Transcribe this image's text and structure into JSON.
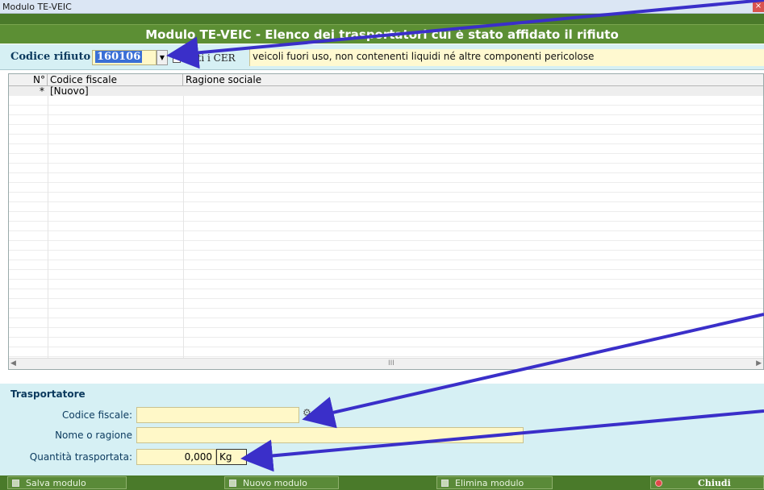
{
  "window": {
    "title": "Modulo TE-VEIC",
    "close_glyph": "×"
  },
  "banner": {
    "title": "Modulo TE-VEIC - Elenco dei trasportatori cui è stato affidato il rifiuto"
  },
  "codice_rifiuto": {
    "label": "Codice rifiuto",
    "value": "160106",
    "dropdown_glyph": "▼",
    "tutti_label": "Tutti i CER",
    "tutti_checked": false,
    "description": "veicoli fuori uso, non contenenti liquidi né altre componenti pericolose"
  },
  "grid": {
    "columns": [
      "N°",
      "Codice fiscale",
      "Ragione sociale"
    ],
    "rows": [
      {
        "n": "*",
        "codice_fiscale": "[Nuovo]",
        "ragione_sociale": ""
      }
    ],
    "scroll_left": "◀",
    "scroll_right": "▶",
    "scroll_thumb": "III"
  },
  "trasportatore": {
    "title": "Trasportatore",
    "codice_fiscale_label": "Codice fiscale:",
    "codice_fiscale_value": "",
    "nome_label": "Nome o ragione",
    "nome_value": "",
    "quantita_label": "Quantità trasportata:",
    "quantita_value": "0,000",
    "unit": "Kg",
    "search_icon_glyph": "⚙"
  },
  "buttons": {
    "salva": "Salva modulo",
    "nuovo": "Nuovo modulo",
    "elimina": "Elimina modulo",
    "chiudi": "Chiudi"
  },
  "colors": {
    "banner_green": "#5c8f34",
    "panel_cyan": "#d6f0f4",
    "field_yellow": "#fff8c8",
    "arrow_blue": "#3a2fc9"
  }
}
